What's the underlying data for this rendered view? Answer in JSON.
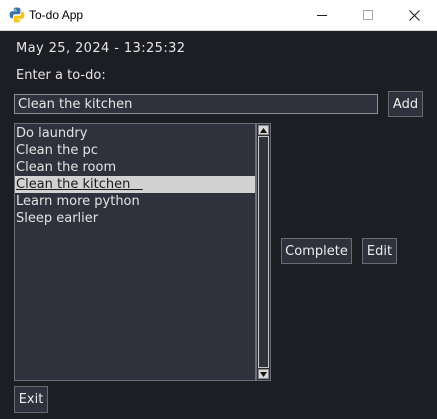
{
  "window": {
    "title": "To-do App",
    "icon": "python-logo-icon"
  },
  "datetime": "May 25, 2024 - 13:25:32",
  "prompt_label": "Enter a to-do:",
  "input": {
    "value": "Clean the kitchen"
  },
  "buttons": {
    "add": "Add",
    "complete": "Complete",
    "edit": "Edit",
    "exit": "Exit"
  },
  "todos": [
    "Do laundry",
    "Clean the pc",
    "Clean the room",
    "Clean the kitchen",
    "Learn more python",
    "Sleep earlier"
  ],
  "selected_todo": "Clean the kitchen",
  "colors": {
    "background": "#1c1e24",
    "panel": "#2f323c",
    "selection": "#d2d2d2",
    "python_blue": "#3a73a8",
    "python_yellow": "#f5c518"
  }
}
